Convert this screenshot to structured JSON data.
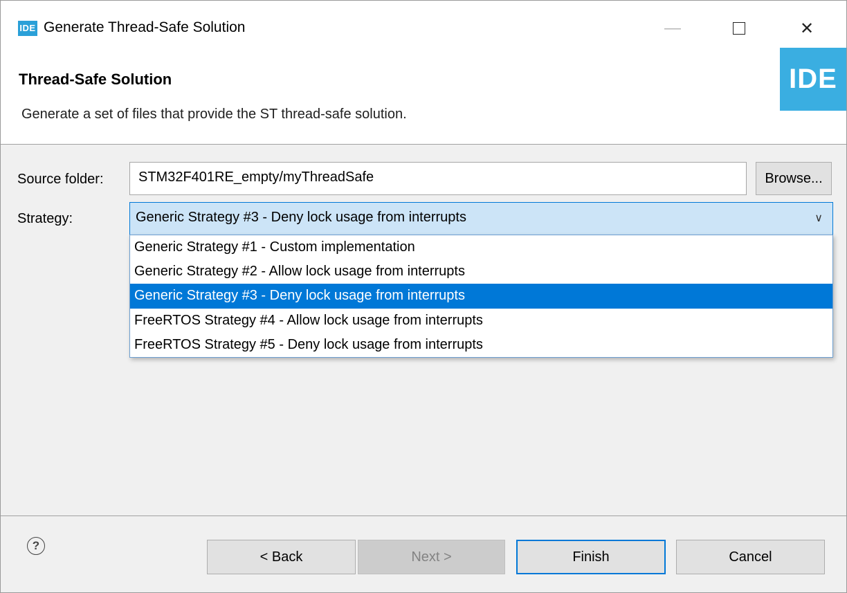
{
  "window": {
    "logo_text": "IDE",
    "title": "Generate Thread-Safe Solution",
    "minimize_glyph": "—",
    "close_glyph": "✕"
  },
  "header": {
    "title": "Thread-Safe Solution",
    "description": "Generate a set of files that provide the ST thread-safe solution.",
    "logo_text": "IDE"
  },
  "form": {
    "source_label": "Source folder:",
    "source_value": "STM32F401RE_empty/myThreadSafe",
    "browse_label": "Browse...",
    "strategy_label": "Strategy:",
    "strategy_selected": "Generic Strategy #3 - Deny lock usage from interrupts",
    "strategy_options": [
      "Generic Strategy #1 - Custom implementation",
      "Generic Strategy #2 - Allow lock usage from interrupts",
      "Generic Strategy #3 - Deny lock usage from interrupts",
      "FreeRTOS Strategy #4 - Allow lock usage from interrupts",
      "FreeRTOS Strategy #5 - Deny lock usage from interrupts"
    ]
  },
  "footer": {
    "help_glyph": "?",
    "back_label": "< Back",
    "next_label": "Next >",
    "finish_label": "Finish",
    "cancel_label": "Cancel"
  },
  "colors": {
    "accent": "#0078d7",
    "logo": "#3aaee1",
    "selected_text": "#ffffff"
  },
  "icons": [
    "ide-logo-icon",
    "minimize-icon",
    "maximize-icon",
    "close-icon",
    "chevron-down-icon",
    "help-icon"
  ]
}
